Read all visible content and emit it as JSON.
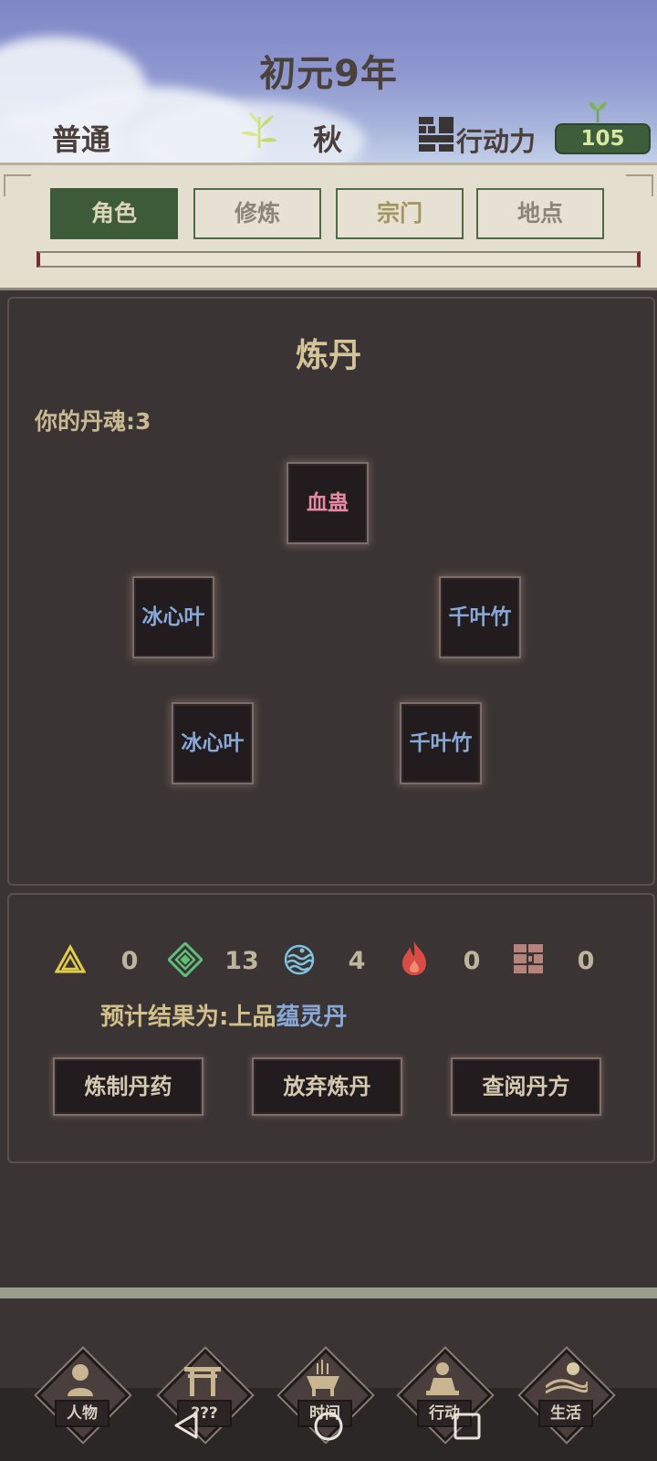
{
  "header": {
    "year_title": "初元9年",
    "difficulty": "普通",
    "season": "秋",
    "action_label": "行动力",
    "action_value": "105"
  },
  "tabs": [
    {
      "label": "角色",
      "active": true
    },
    {
      "label": "修炼",
      "active": false
    },
    {
      "label": "宗门",
      "active": false
    },
    {
      "label": "地点",
      "active": false
    }
  ],
  "alchemy": {
    "title": "炼丹",
    "soul_label": "你的丹魂:3",
    "slots": [
      "血蛊",
      "冰心叶",
      "千叶竹",
      "冰心叶",
      "千叶竹"
    ]
  },
  "elements": [
    {
      "icon": "earth-triangle-icon",
      "value": "0"
    },
    {
      "icon": "wood-diamond-icon",
      "value": "13"
    },
    {
      "icon": "water-wave-icon",
      "value": "4"
    },
    {
      "icon": "fire-flame-icon",
      "value": "0"
    },
    {
      "icon": "metal-block-icon",
      "value": "0"
    }
  ],
  "prediction": {
    "prefix": "预计结果为:上品",
    "result": "蕴灵丹"
  },
  "buttons": [
    "炼制丹药",
    "放弃炼丹",
    "查阅丹方"
  ],
  "nav": [
    "人物",
    "???",
    "时间",
    "行动",
    "生活"
  ],
  "colors": {
    "accent_green": "#3d5a39",
    "herb_blue": "#88a8d6",
    "blood_pink": "#e58aa2",
    "title_gold": "#d3c49a"
  }
}
